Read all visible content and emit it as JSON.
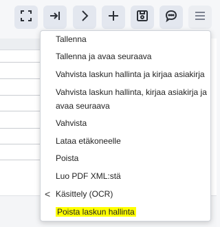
{
  "toolbar": {
    "buttons": [
      {
        "name": "fullscreen",
        "icon": "fullscreen-icon"
      },
      {
        "name": "next-to-end",
        "icon": "arrow-right-to-line-icon"
      },
      {
        "name": "next",
        "icon": "chevron-right-icon"
      },
      {
        "name": "add",
        "icon": "plus-icon"
      },
      {
        "name": "save",
        "icon": "save-icon"
      },
      {
        "name": "comment",
        "icon": "comment-icon"
      },
      {
        "name": "menu",
        "icon": "hamburger-icon"
      }
    ]
  },
  "menu": {
    "items": [
      {
        "label": "Tallenna"
      },
      {
        "label": "Tallenna ja avaa seuraava"
      },
      {
        "label": "Vahvista laskun hallinta ja kirjaa asiakirja"
      },
      {
        "label": "Vahvista laskun hallinta, kirjaa asiakirja ja avaa seuraava"
      },
      {
        "label": "Vahvista"
      },
      {
        "label": "Lataa etäkoneelle"
      },
      {
        "label": "Poista"
      },
      {
        "label": "Luo PDF XML:stä"
      },
      {
        "label": "Käsittely (OCR)",
        "submenu_caret": "<"
      },
      {
        "label": "Poista laskun hallinta",
        "highlighted": true
      }
    ]
  },
  "colors": {
    "toolbar_button_bg": "#e3e7ef",
    "highlight": "#ffff00",
    "text": "#222222"
  }
}
